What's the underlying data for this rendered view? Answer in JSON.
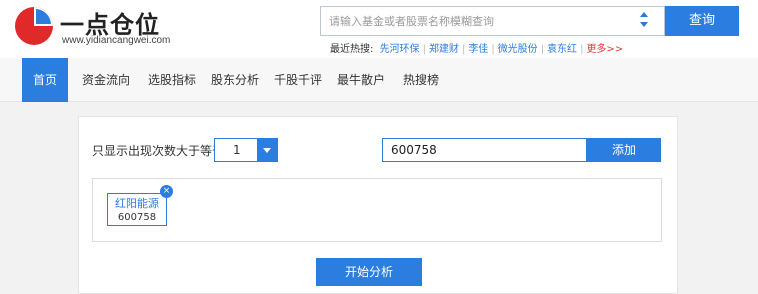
{
  "header": {
    "logo_text": "一点仓位",
    "logo_url": "www.yidiancangwei.com",
    "search_placeholder": "请输入基金或者股票名称模糊查询",
    "search_button": "查询",
    "hot_label": "最近热搜:",
    "hot_items": [
      "先河环保",
      "郑建财",
      "李佳",
      "微光股份",
      "袁东红"
    ],
    "hot_more": "更多>>"
  },
  "nav": {
    "items": [
      "首页",
      "资金流向",
      "选股指标",
      "股东分析",
      "千股千评",
      "最牛散户",
      "热搜榜"
    ],
    "active_index": 0
  },
  "filter": {
    "label": "只显示出现次数大于等于",
    "count_value": "1",
    "stock_input_value": "600758",
    "add_button": "添加"
  },
  "tags": [
    {
      "name": "红阳能源",
      "code": "600758"
    }
  ],
  "start_button": "开始分析",
  "colors": {
    "accent": "#2b7de0",
    "logo_red": "#e02a2a",
    "hot_more": "#e03b3b"
  }
}
